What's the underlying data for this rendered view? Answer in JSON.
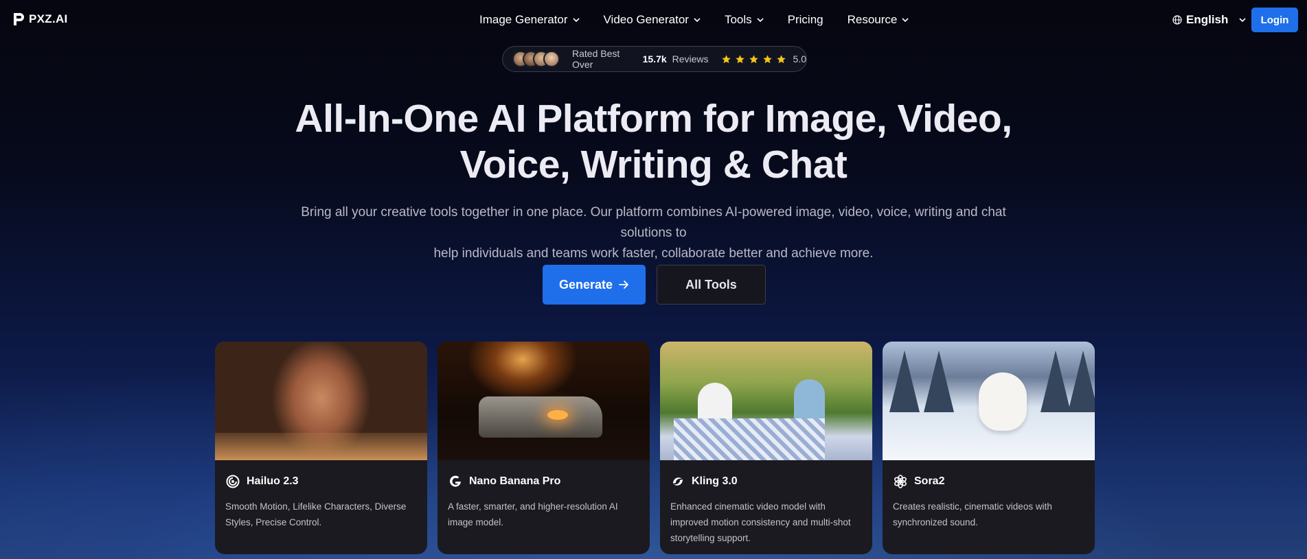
{
  "brand": {
    "name": "PXZ.AI"
  },
  "nav": {
    "items": [
      {
        "label": "Image Generator",
        "dropdown": true
      },
      {
        "label": "Video Generator",
        "dropdown": true
      },
      {
        "label": "Tools",
        "dropdown": true
      },
      {
        "label": "Pricing",
        "dropdown": false
      },
      {
        "label": "Resource",
        "dropdown": true
      }
    ],
    "language": "English",
    "login_label": "Login"
  },
  "rating": {
    "prefix": "Rated Best Over",
    "count": "15.7k",
    "suffix": "Reviews",
    "stars": 5,
    "score": "5.0"
  },
  "hero": {
    "title_line1": "All-In-One AI Platform for Image, Video,",
    "title_line2": "Voice, Writing & Chat",
    "subtitle_line1": "Bring all your creative tools together in one place. Our platform combines AI-powered image, video, voice, writing and chat solutions to",
    "subtitle_line2": "help individuals and teams work faster, collaborate better and achieve more.",
    "generate_label": "Generate",
    "all_tools_label": "All Tools"
  },
  "cards": [
    {
      "title": "Hailuo 2.3",
      "icon": "hailuo-icon",
      "description": "Smooth Motion, Lifelike Characters, Diverse Styles, Precise Control."
    },
    {
      "title": "Nano Banana Pro",
      "icon": "google-g-icon",
      "description": "A faster, smarter, and higher-resolution AI image model."
    },
    {
      "title": "Kling 3.0",
      "icon": "kling-icon",
      "description": "Enhanced cinematic video model with improved motion consistency and multi-shot storytelling support."
    },
    {
      "title": "Sora2",
      "icon": "openai-icon",
      "description": "Creates realistic, cinematic videos with synchronized sound."
    }
  ],
  "colors": {
    "accent": "#1f6feb",
    "star": "#f5c518",
    "card_bg": "#1a1a20"
  }
}
